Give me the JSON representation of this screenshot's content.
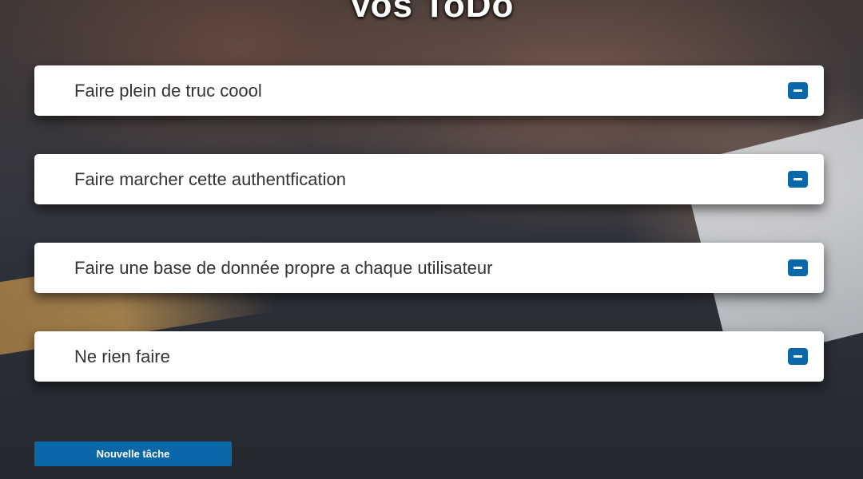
{
  "header": {
    "title": "Vos ToDo"
  },
  "todos": [
    {
      "text": "Faire plein de truc coool",
      "action_icon": "minus-icon"
    },
    {
      "text": "Faire marcher cette authentfication",
      "action_icon": "minus-icon"
    },
    {
      "text": "Faire une base de donnée propre a chaque utilisateur",
      "action_icon": "minus-icon"
    },
    {
      "text": "Ne rien faire",
      "action_icon": "minus-icon"
    }
  ],
  "actions": {
    "new_task_label": "Nouvelle tâche"
  },
  "colors": {
    "accent": "#0b68a8",
    "card": "#ffffff",
    "text": "#333333"
  }
}
